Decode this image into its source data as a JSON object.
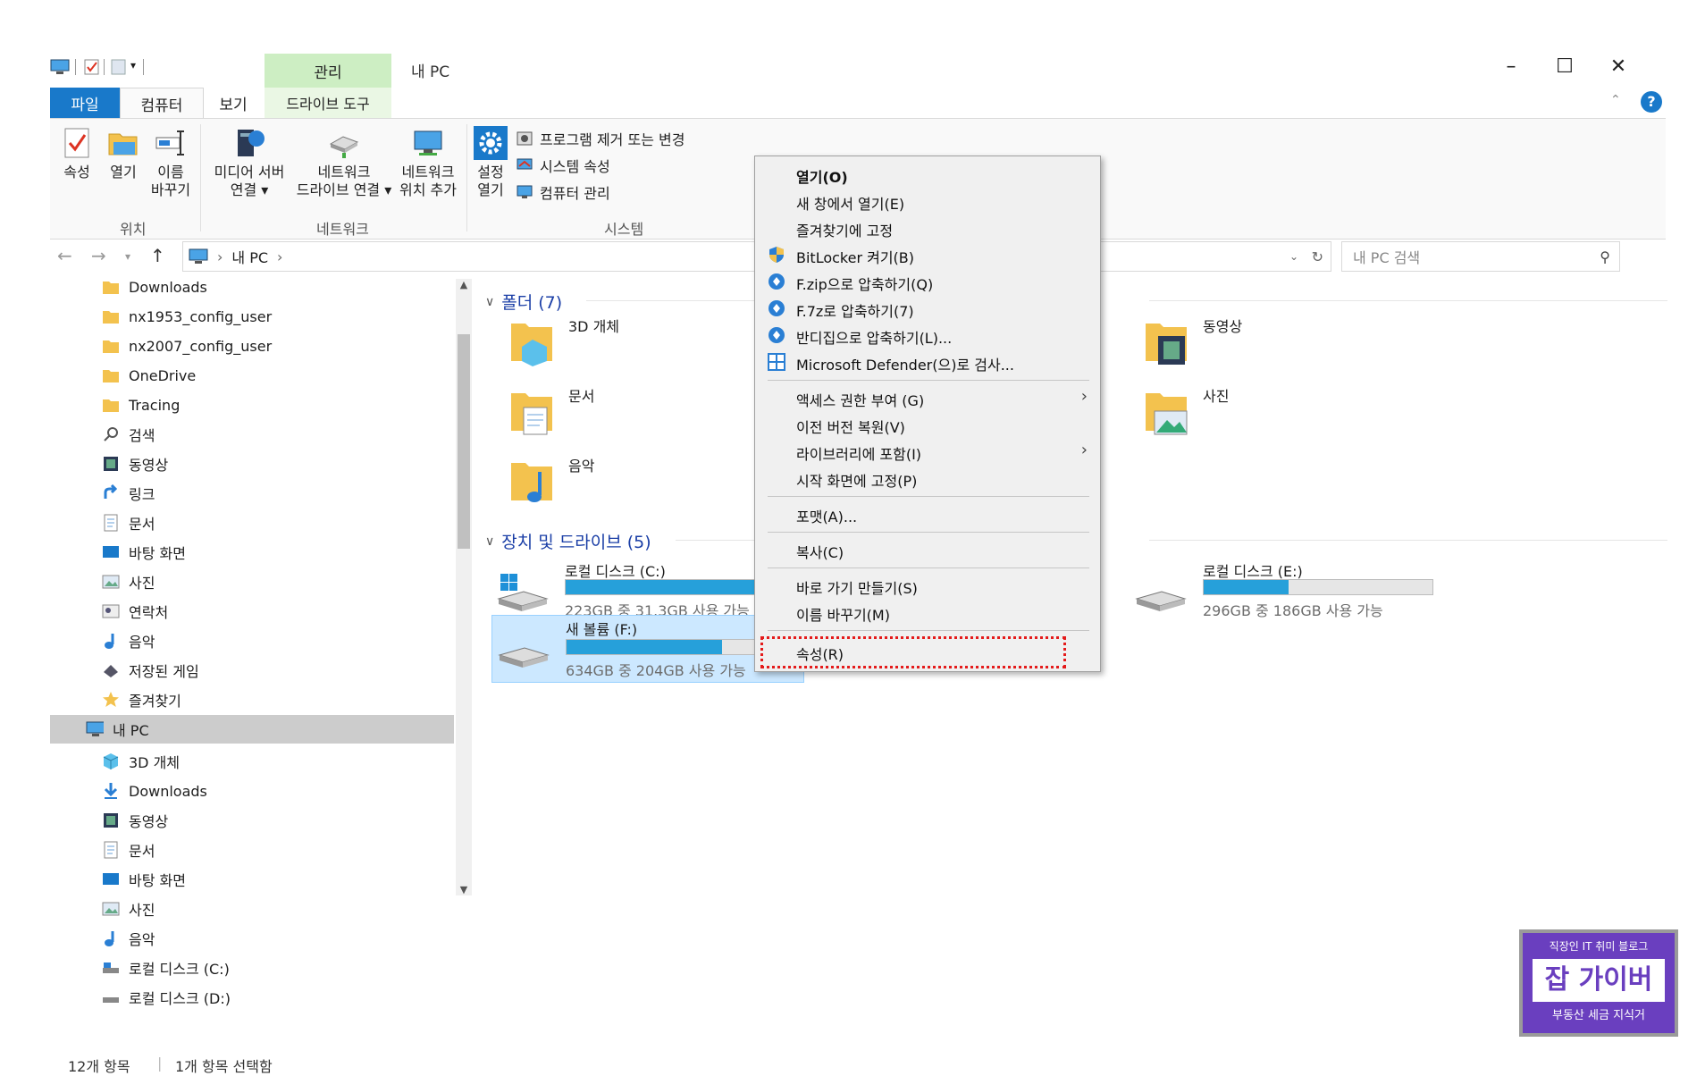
{
  "titlebar": {
    "manage_tab": "관리",
    "title": "내 PC",
    "minimize": "–",
    "maximize": "☐",
    "close": "✕"
  },
  "tabs": {
    "file": "파일",
    "computer": "컴퓨터",
    "view": "보기",
    "drive_tools": "드라이브 도구"
  },
  "ribbon": {
    "location": {
      "label": "위치",
      "properties": "속성",
      "open": "열기",
      "rename_1": "이름",
      "rename_2": "바꾸기"
    },
    "network": {
      "label": "네트워크",
      "media_server_1": "미디어 서버",
      "media_server_2": "연결 ▾",
      "map_drive_1": "네트워크",
      "map_drive_2": "드라이브 연결 ▾",
      "add_location_1": "네트워크",
      "add_location_2": "위치 추가"
    },
    "system": {
      "label": "시스템",
      "settings_1": "설정",
      "settings_2": "열기",
      "uninstall": "프로그램 제거 또는 변경",
      "sys_props": "시스템 속성",
      "manage": "컴퓨터 관리"
    }
  },
  "address": {
    "path_root": "내 PC",
    "chevron": "›",
    "search_placeholder": "내 PC 검색"
  },
  "nav": {
    "items": [
      "Downloads",
      "nx1953_config_user",
      "nx2007_config_user",
      "OneDrive",
      "Tracing",
      "검색",
      "동영상",
      "링크",
      "문서",
      "바탕 화면",
      "사진",
      "연락처",
      "음악",
      "저장된 게임",
      "즐겨찾기"
    ],
    "this_pc": "내 PC",
    "pc_items": [
      "3D 개체",
      "Downloads",
      "동영상",
      "문서",
      "바탕 화면",
      "사진",
      "음악",
      "로컬 디스크 (C:)",
      "로컬 디스크 (D:)"
    ]
  },
  "content": {
    "folders_header": "폴더 (7)",
    "folders": [
      "3D 개체",
      "문서",
      "음악",
      "동영상",
      "사진"
    ],
    "drives_header": "장치 및 드라이브 (5)",
    "drives": [
      {
        "name": "로컬 디스크 (C:)",
        "free": "223GB 중 31.3GB 사용 가능",
        "used_fraction": 0.86
      },
      {
        "name": "새 볼륨 (F:)",
        "free": "634GB 중 204GB 사용 가능",
        "used_fraction": 0.68
      },
      {
        "name": "로컬 디스크 (E:)",
        "free": "296GB 중 186GB 사용 가능",
        "used_fraction": 0.37
      }
    ]
  },
  "status": {
    "count": "12개 항목",
    "selected": "1개 항목 선택함"
  },
  "context_menu": {
    "items": [
      "열기(O)",
      "새 창에서 열기(E)",
      "즐겨찾기에 고정",
      "BitLocker 켜기(B)",
      "F.zip으로 압축하기(Q)",
      "F.7z로 압축하기(7)",
      "반디집으로 압축하기(L)...",
      "Microsoft Defender(으)로 검사...",
      "액세스 권한 부여 (G)",
      "이전 버전 복원(V)",
      "라이브러리에 포함(I)",
      "시작 화면에 고정(P)",
      "포맷(A)...",
      "복사(C)",
      "바로 가기 만들기(S)",
      "이름 바꾸기(M)",
      "속성(R)"
    ],
    "submenu_arrow": "›"
  },
  "watermark": {
    "line1": "직장인 IT 취미 블로그",
    "line2": "잡 가이버",
    "line3": "부동산 세금 지식거"
  },
  "colors": {
    "accent": "#1979ca",
    "drive_bar": "#26a0da",
    "manage_tab": "#cdeec3",
    "highlight": "#e41b1b"
  }
}
